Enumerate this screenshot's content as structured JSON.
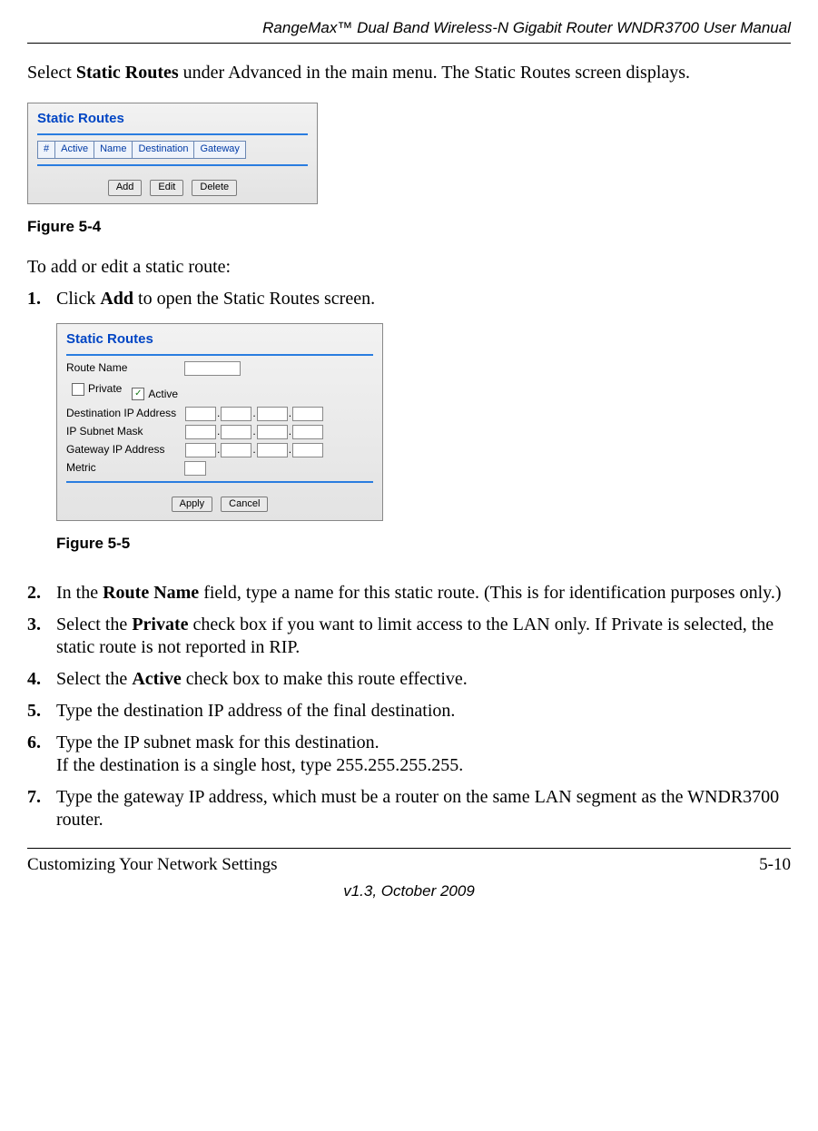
{
  "header": {
    "title": "RangeMax™ Dual Band Wireless-N Gigabit Router WNDR3700 User Manual"
  },
  "intro": {
    "pre": "Select ",
    "bold": "Static Routes",
    "post": " under Advanced in the main menu. The Static Routes screen displays."
  },
  "panel1": {
    "title": "Static Routes",
    "cols": {
      "num": "#",
      "active": "Active",
      "name": "Name",
      "dest": "Destination",
      "gw": "Gateway"
    },
    "buttons": {
      "add": "Add",
      "edit": "Edit",
      "del": "Delete"
    }
  },
  "fig1_caption": "Figure 5-4",
  "lead_in": "To add or edit a static route:",
  "step1": {
    "num": "1.",
    "pre": "Click ",
    "bold": "Add",
    "post": " to open the Static Routes screen."
  },
  "panel2": {
    "title": "Static Routes",
    "labels": {
      "route_name": "Route Name",
      "private": "Private",
      "active": "Active",
      "dest_ip": "Destination IP Address",
      "mask": "IP Subnet Mask",
      "gw": "Gateway IP Address",
      "metric": "Metric"
    },
    "buttons": {
      "apply": "Apply",
      "cancel": "Cancel"
    },
    "dot": ".",
    "check": "✓"
  },
  "fig2_caption": "Figure 5-5",
  "step2": {
    "num": "2.",
    "pre": "In the ",
    "bold": "Route Name",
    "post": " field, type a name for this static route. (This is for identification purposes only.)"
  },
  "step3": {
    "num": "3.",
    "pre": "Select the ",
    "bold": "Private",
    "post": " check box if you want to limit access to the LAN only. If Private is selected, the static route is not reported in RIP."
  },
  "step4": {
    "num": "4.",
    "pre": "Select the ",
    "bold": "Active",
    "post": " check box to make this route effective."
  },
  "step5": {
    "num": "5.",
    "text": "Type the destination IP address of the final destination."
  },
  "step6": {
    "num": "6.",
    "line1": "Type the IP subnet mask for this destination.",
    "line2": "If the destination is a single host, type 255.255.255.255."
  },
  "step7": {
    "num": "7.",
    "text": "Type the gateway IP address, which must be a router on the same LAN segment as the WNDR3700 router."
  },
  "footer": {
    "left": "Customizing Your Network Settings",
    "right": "5-10",
    "version": "v1.3, October 2009"
  }
}
